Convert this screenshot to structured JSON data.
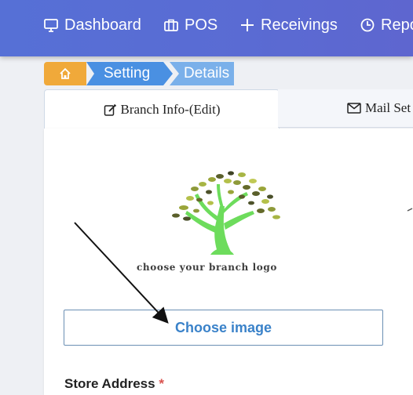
{
  "nav": {
    "items": [
      {
        "label": "Dashboard",
        "icon": "monitor-icon"
      },
      {
        "label": "POS",
        "icon": "briefcase-icon"
      },
      {
        "label": "Receivings",
        "icon": "plus-icon"
      },
      {
        "label": "Repo",
        "icon": "clock-icon"
      }
    ]
  },
  "breadcrumb": {
    "home_icon": "home-icon",
    "items": [
      "Setting",
      "Details"
    ]
  },
  "tabs": [
    {
      "label": "Branch Info-(Edit)",
      "icon": "edit-icon",
      "active": true
    },
    {
      "label": "Mail Set",
      "icon": "mail-icon",
      "active": false
    }
  ],
  "logo": {
    "caption": "choose your branch logo"
  },
  "form": {
    "choose_image_label": "Choose image",
    "store_address_label": "Store Address",
    "required_mark": "*"
  },
  "colors": {
    "navbar": "#5670d6",
    "breadcrumb_home": "#f0a93a",
    "breadcrumb_setting": "#4a90e2",
    "breadcrumb_details": "#7ab0ea",
    "button_text": "#3a82c9",
    "required": "#d9534f"
  }
}
